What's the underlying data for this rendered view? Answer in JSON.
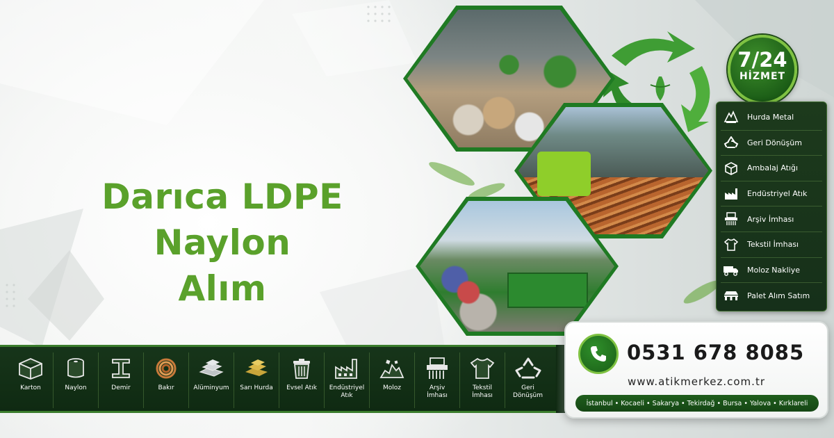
{
  "headline": {
    "line1": "Darıca LDPE",
    "line2": "Naylon",
    "line3": "Alım"
  },
  "badge": {
    "top": "7/24",
    "bottom": "HİZMET"
  },
  "services": [
    {
      "label": "Hurda Metal",
      "icon": "scrap-metal-icon"
    },
    {
      "label": "Geri Dönüşüm",
      "icon": "recycle-icon"
    },
    {
      "label": "Ambalaj Atığı",
      "icon": "box-icon"
    },
    {
      "label": "Endüstriyel Atık",
      "icon": "factory-icon"
    },
    {
      "label": "Arşiv İmhası",
      "icon": "shredder-icon"
    },
    {
      "label": "Tekstil İmhası",
      "icon": "shirt-icon"
    },
    {
      "label": "Moloz Nakliye",
      "icon": "truck-icon"
    },
    {
      "label": "Palet Alım Satım",
      "icon": "pallet-icon"
    }
  ],
  "categories": [
    {
      "label": "Karton",
      "icon": "cardboard-box-icon"
    },
    {
      "label": "Naylon",
      "icon": "nylon-roll-icon"
    },
    {
      "label": "Demir",
      "icon": "iron-beam-icon"
    },
    {
      "label": "Bakır",
      "icon": "copper-coil-icon"
    },
    {
      "label": "Alüminyum",
      "icon": "aluminum-bars-icon"
    },
    {
      "label": "Sarı Hurda",
      "icon": "brass-bars-icon"
    },
    {
      "label": "Evsel Atık",
      "icon": "trash-bin-icon"
    },
    {
      "label": "Endüstriyel\nAtık",
      "icon": "factory-icon"
    },
    {
      "label": "Moloz",
      "icon": "rubble-icon"
    },
    {
      "label": "Arşiv\nİmhası",
      "icon": "shredder-icon"
    },
    {
      "label": "Tekstil\nİmhası",
      "icon": "shirt-icon"
    },
    {
      "label": "Geri\nDönüşüm",
      "icon": "recycle-icon"
    }
  ],
  "contact": {
    "phone": "0531 678 8085",
    "website": "www.atikmerkez.com.tr",
    "cities": "İstanbul • Kocaeli • Sakarya • Tekirdağ • Bursa • Yalova • Kırklareli"
  },
  "colors": {
    "brand_green": "#5aa12b",
    "dark_green": "#17351a",
    "accent_green": "#7fc242"
  }
}
